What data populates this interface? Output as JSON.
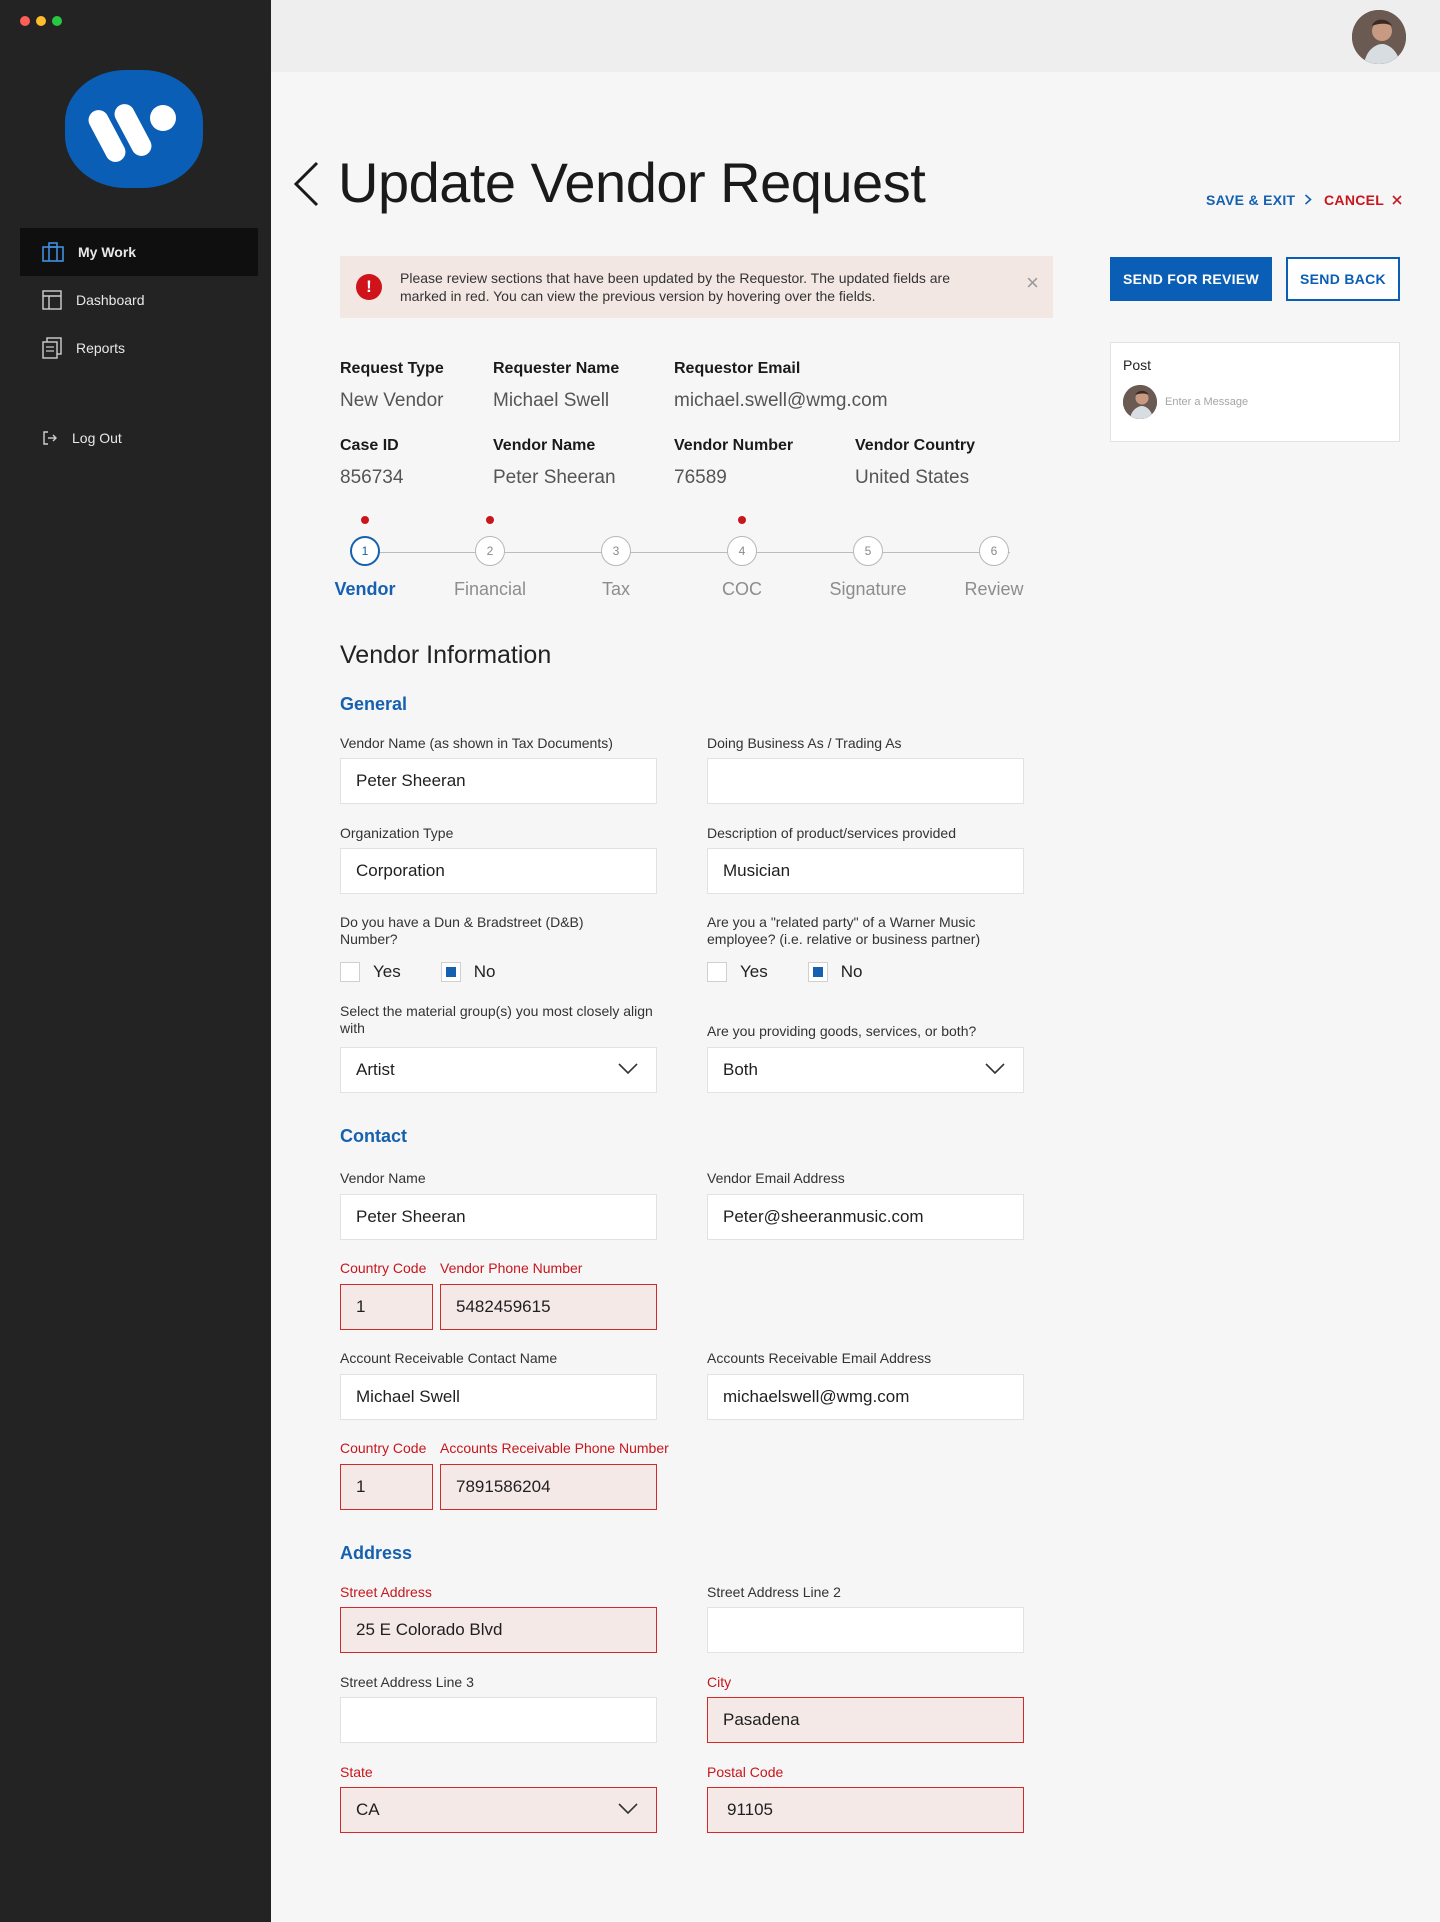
{
  "window": {
    "dot_colors": [
      "#fe5f57",
      "#febc2e",
      "#28c840"
    ]
  },
  "sidebar": {
    "brand_color": "#0a5eb5",
    "items": [
      {
        "label": "My Work",
        "icon": "briefcase-icon"
      },
      {
        "label": "Dashboard",
        "icon": "dashboard-icon"
      },
      {
        "label": "Reports",
        "icon": "reports-icon"
      }
    ],
    "logout": {
      "label": "Log Out",
      "icon": "logout-icon"
    }
  },
  "header": {
    "title": "Update Vendor Request",
    "save_exit": "SAVE & EXIT",
    "cancel": "CANCEL"
  },
  "alert": {
    "text": "Please review sections that have been updated by the Requestor. The updated fields are marked in red. You can view the previous version by hovering over the fields.",
    "icon_text": "!",
    "close": "×"
  },
  "actions": {
    "send_for_review": "SEND FOR REVIEW",
    "send_back": "SEND BACK"
  },
  "post": {
    "title": "Post",
    "placeholder": "Enter a Message"
  },
  "summary": {
    "request_type": {
      "label": "Request Type",
      "value": "New Vendor"
    },
    "requester_name": {
      "label": "Requester Name",
      "value": "Michael Swell"
    },
    "requestor_email": {
      "label": "Requestor Email",
      "value": "michael.swell@wmg.com"
    },
    "case_id": {
      "label": "Case ID",
      "value": "856734"
    },
    "vendor_name": {
      "label": "Vendor Name",
      "value": "Peter Sheeran"
    },
    "vendor_number": {
      "label": "Vendor Number",
      "value": "76589"
    },
    "vendor_country": {
      "label": "Vendor Country",
      "value": "United States"
    }
  },
  "steps": [
    {
      "num": "1",
      "label": "Vendor",
      "active": true,
      "updated": true
    },
    {
      "num": "2",
      "label": "Financial",
      "active": false,
      "updated": true
    },
    {
      "num": "3",
      "label": "Tax",
      "active": false,
      "updated": false
    },
    {
      "num": "4",
      "label": "COC",
      "active": false,
      "updated": true
    },
    {
      "num": "5",
      "label": "Signature",
      "active": false,
      "updated": false
    },
    {
      "num": "6",
      "label": "Review",
      "active": false,
      "updated": false
    }
  ],
  "form": {
    "section_title": "Vendor Information",
    "general": {
      "title": "General",
      "vendor_name": {
        "label": "Vendor Name (as shown in Tax Documents)",
        "value": "Peter Sheeran"
      },
      "dba": {
        "label": "Doing Business As / Trading As",
        "value": ""
      },
      "org_type": {
        "label": "Organization Type",
        "value": "Corporation"
      },
      "description": {
        "label": "Description of product/services provided",
        "value": "Musician"
      },
      "dnb": {
        "label": "Do you have a Dun & Bradstreet (D&B) Number?",
        "yes": "Yes",
        "no": "No",
        "selected": "No"
      },
      "related_party": {
        "label": "Are you a \"related party\" of a Warner Music employee? (i.e. relative or business partner)",
        "yes": "Yes",
        "no": "No",
        "selected": "No"
      },
      "material_group": {
        "label": "Select the material group(s) you most closely align with",
        "value": "Artist"
      },
      "goods_services": {
        "label": "Are you providing goods, services, or both?",
        "value": "Both"
      }
    },
    "contact": {
      "title": "Contact",
      "vendor_name": {
        "label": "Vendor Name",
        "value": "Peter Sheeran"
      },
      "vendor_email": {
        "label": "Vendor Email Address",
        "value": "Peter@sheeranmusic.com"
      },
      "country_code_1": {
        "label": "Country Code",
        "value": "1"
      },
      "vendor_phone": {
        "label": "Vendor Phone Number",
        "value": "5482459615"
      },
      "ar_contact_name": {
        "label": "Account Receivable Contact Name",
        "value": "Michael Swell"
      },
      "ar_email": {
        "label": "Accounts Receivable Email Address",
        "value": "michaelswell@wmg.com"
      },
      "country_code_2": {
        "label": "Country Code",
        "value": "1"
      },
      "ar_phone": {
        "label": "Accounts Receivable Phone Number",
        "value": "7891586204"
      }
    },
    "address": {
      "title": "Address",
      "street": {
        "label": "Street Address",
        "value": "25 E Colorado Blvd"
      },
      "street2": {
        "label": "Street Address Line 2",
        "value": ""
      },
      "street3": {
        "label": "Street Address Line 3",
        "value": ""
      },
      "city": {
        "label": "City",
        "value": "Pasadena"
      },
      "state": {
        "label": "State",
        "value": "CA"
      },
      "postal": {
        "label": "Postal Code",
        "value": "91105"
      }
    }
  }
}
